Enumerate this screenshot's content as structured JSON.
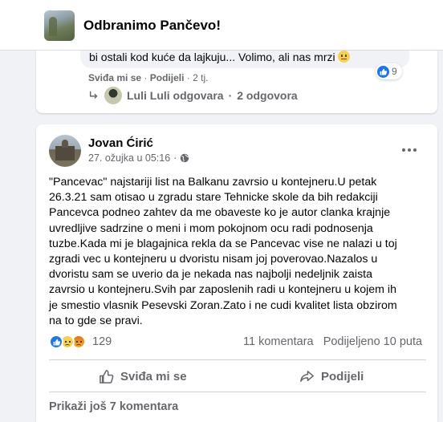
{
  "header": {
    "group_name": "Odbranimo Pančevo!"
  },
  "previous_comment": {
    "text": "bi ostali kod kuće da lajkuju... Volimo, ali nas mrzi",
    "emoji": "neutral-face-emoji",
    "like_label": "Sviđa mi se",
    "reply_label": "Podijeli",
    "time": "2 tj.",
    "like_count": "9",
    "reply_author_action": "Luli Luli odgovara",
    "reply_count": "2 odgovora"
  },
  "post": {
    "author": "Jovan Ćirić",
    "date": "27. ožujka u 05:16",
    "privacy_icon": "globe-icon",
    "lines": [
      "\"Pancevac\" najstariji list na Balkanu zavrsio u kontejneru.U petak",
      "26.3.21 sam otisao u zgradu stare Tehnicke skole da bih redakciji",
      "Pancevca podneo zahtev da me obaveste ko je autor clanka krajnje",
      "uvredljive sadrzine o meni i mom pokojnom ocu radi podnosenja",
      "tuzbe.Kada mi je blagajnica rekla da se Pancevac vise ne nalazi u toj",
      "zgradi vec u kontejneru u dvoristu nisam joj poverovao.Nazalos u",
      "dvoristu sam se uverio da je nekada nas najbolji nedeljnik zaista",
      "zavrsio u kontejneru.Svih par zaposlenih radi u kontejneru u kojem ih",
      "je smestio vlasnik Pesevski Zoran.Zato i ne cudi kvalitet lista obzirom",
      "na to gde se pravi."
    ],
    "reactions": [
      "like",
      "sad",
      "angry"
    ],
    "reaction_count": "129",
    "comments_count": "11 komentara",
    "shares_count": "Podijeljeno 10 puta",
    "like_button": "Sviđa mi se",
    "share_button": "Podijeli",
    "more_comments": "Prikaži još 7 komentara"
  },
  "colors": {
    "accent": "#1877f2",
    "secondary_text": "#65676b",
    "background": "#f0f2f5"
  }
}
